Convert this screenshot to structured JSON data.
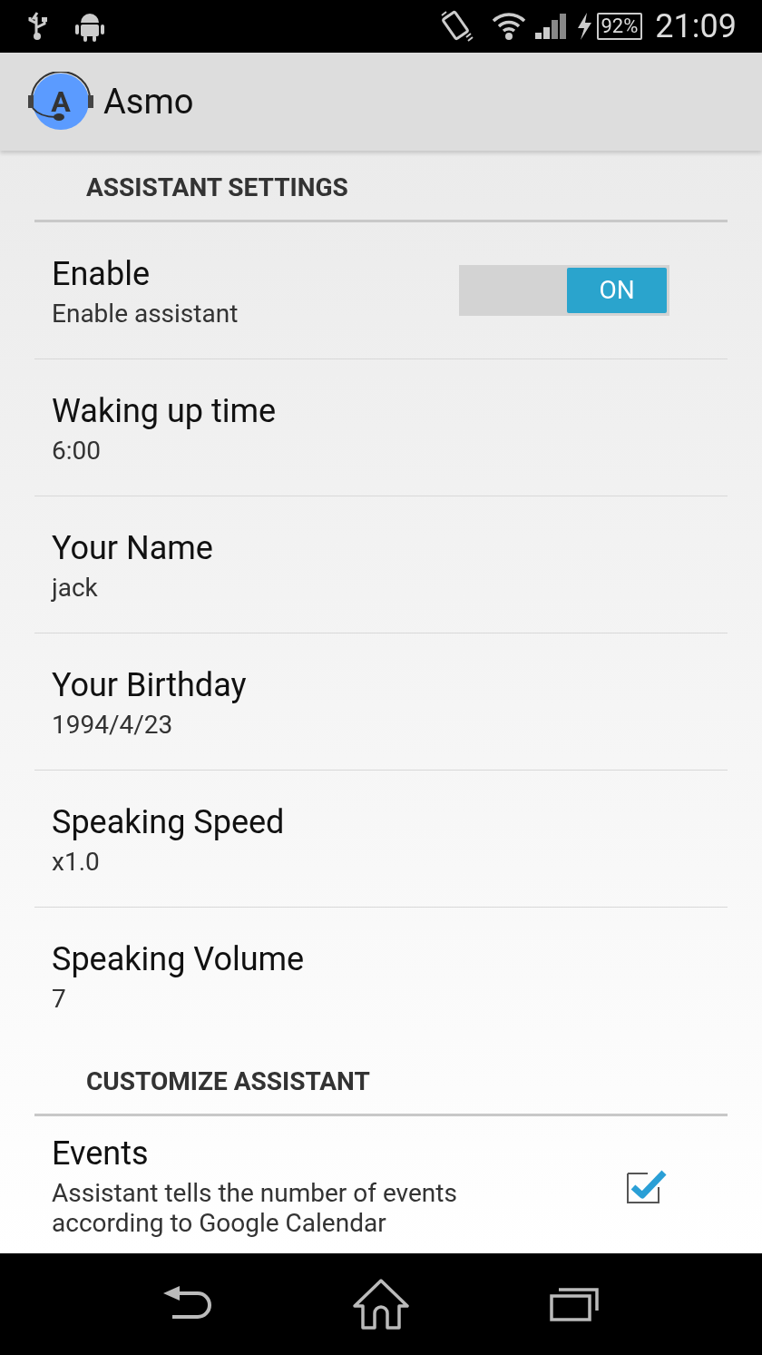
{
  "status_bar": {
    "battery": "92%",
    "time": "21:09"
  },
  "app_bar": {
    "logo_letter": "A",
    "title": "Asmo"
  },
  "sections": [
    {
      "title": "ASSISTANT SETTINGS",
      "items": [
        {
          "kind": "switch",
          "title": "Enable",
          "summary": "Enable assistant",
          "on": true,
          "switch_label": "ON"
        },
        {
          "kind": "plain",
          "title": "Waking up time",
          "summary": "6:00"
        },
        {
          "kind": "plain",
          "title": "Your Name",
          "summary": "jack"
        },
        {
          "kind": "plain",
          "title": "Your Birthday",
          "summary": "1994/4/23"
        },
        {
          "kind": "plain",
          "title": "Speaking Speed",
          "summary": "x1.0"
        },
        {
          "kind": "plain",
          "title": "Speaking Volume",
          "summary": "7"
        }
      ]
    },
    {
      "title": "CUSTOMIZE ASSISTANT",
      "items": [
        {
          "kind": "checkbox",
          "title": "Events",
          "summary": "Assistant tells the number of events according to Google Calendar",
          "checked": true
        }
      ]
    }
  ]
}
